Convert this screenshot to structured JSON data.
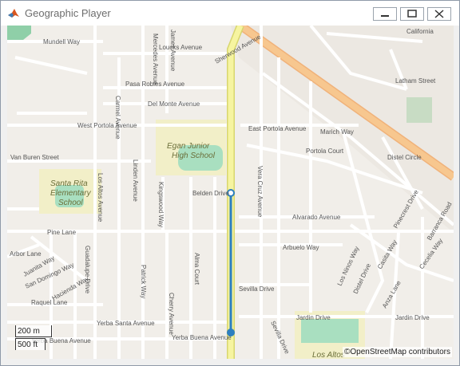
{
  "window": {
    "title": "Geographic Player",
    "controls": {
      "minimize": "minimize",
      "maximize": "maximize",
      "close": "close"
    }
  },
  "map": {
    "attribution": "©OpenStreetMap contributors",
    "scale": {
      "metric": "200 m",
      "imperial": "500 ft"
    },
    "labels": {
      "mundell": "Mundell Way",
      "loucks": "Loucks Avenue",
      "mercedes": "Mercedes Avenue",
      "james": "James Avenue",
      "pasa_robles": "Pasa Robles Avenue",
      "del_monte": "Del Monte Avenue",
      "west_portola": "West Portola Avenue",
      "east_portola": "East Portola Avenue",
      "buren": "Van Buren Street",
      "sherwood": "Sherwood Avenue",
      "latham": "Latham Street",
      "marich": "Marich Way",
      "distel_circle": "Distel Circle",
      "portola_court": "Portola Court",
      "vera_cruz": "Vera Cruz Avenue",
      "belden": "Belden Drive",
      "alvarado": "Alvarado Avenue",
      "arbuelo": "Arbuelo Way",
      "pine": "Pine Lane",
      "arbor": "Arbor Lane",
      "juanita": "Juanita Way",
      "san_domingo": "San Domingo Way",
      "hacienda": "Hacienda Way",
      "raquel": "Raquel Lane",
      "yerba_santa": "Yerba Santa Avenue",
      "yerba_buena": "Yerba Buena Avenue",
      "sevilla": "Sevilla Drive",
      "jardin": "Jardin Drive",
      "jardin2": "Jardin Drive",
      "los_altos": "Los Altos Avenue",
      "linden": "Linden Avenue",
      "kingswood": "Kingswood Way",
      "alma": "Alma Court",
      "cherry": "Cherry Avenue",
      "patrick": "Patrick Way",
      "guadalupe": "Guadalupe Drive",
      "carmel": "Carmel Avenue",
      "los_ninos": "Los Ninos Way",
      "distel_drive": "Distel Drive",
      "casita": "Casita Way",
      "cecelia": "Cecelia Way",
      "barranca": "Barranca Road",
      "pinecrest": "Pinecrest Drive",
      "anza": "Anza Lane",
      "egan": "Egan Junior High School",
      "egan1": "Egan Junior",
      "egan2": "High School",
      "santa_rita1": "Santa Rita",
      "santa_rita2": "Elementary",
      "santa_rita3": "School",
      "los_altos_hs": "Los Altos",
      "california": "California"
    },
    "colors": {
      "background": "#f1eee9",
      "roads": "#ffffff",
      "main_road": "#f6f4a0",
      "arterial": "#f7c78f",
      "school": "#f2efc8",
      "park": "#a9dfc0",
      "route": "#2d7fc0"
    }
  }
}
